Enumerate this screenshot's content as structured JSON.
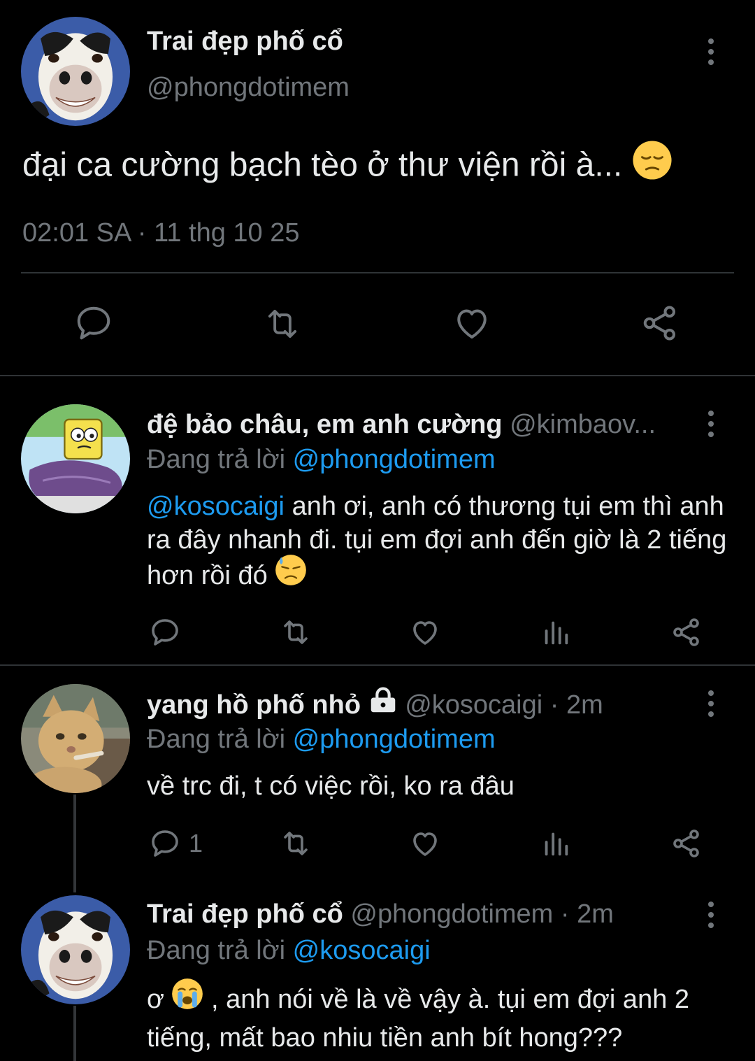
{
  "main_tweet": {
    "name": "Trai đẹp phố cổ",
    "handle": "@phongdotimem",
    "text": "đại ca cường bạch tèo ở thư viện rồi à...",
    "emoji": "pensive",
    "timestamp": "02:01 SA · 11 thg 10 25",
    "actions": [
      "reply-icon",
      "retweet-icon",
      "like-icon",
      "share-icon"
    ]
  },
  "replies": [
    {
      "name": "đệ bảo châu, em anh cường",
      "handle": "@kimbaov...",
      "time": "",
      "replying_label": "Đang trả lời",
      "replying_to": "@phongdotimem",
      "mention": "@kosocaigi",
      "text": "anh ơi, anh có thương tụi em thì anh ra đây nhanh đi. tụi em đợi anh đến giờ là 2 tiếng hơn rồi đó",
      "emoji": "downcast-sweat",
      "reply_count": ""
    },
    {
      "name": "yang hồ phố nhỏ",
      "handle": "@kosocaigi",
      "time": "· 2m",
      "replying_label": "Đang trả lời",
      "replying_to": "@phongdotimem",
      "text": "về trc đi, t có việc rồi, ko ra đâu",
      "reply_count": "1"
    },
    {
      "name": "Trai đẹp phố cổ",
      "handle": "@phongdotimem",
      "time": "· 2m",
      "replying_label": "Đang trả lời",
      "replying_to": "@kosocaigi",
      "text_before_emoji": "ơ",
      "emoji": "loudly-crying",
      "text_after_emoji": ", anh nói về là về vậy à. tụi em đợi anh 2 tiếng, mất bao nhiu tiền anh bít hong???"
    }
  ],
  "colors": {
    "background": "#000000",
    "text": "#e7e9ea",
    "secondary": "#71767b",
    "link": "#1d9bf0",
    "divider": "#2f3336"
  }
}
